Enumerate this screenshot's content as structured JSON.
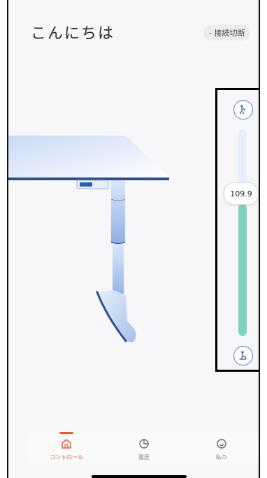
{
  "header": {
    "greeting": "こんにちは",
    "disconnect_label": "- 接続切断"
  },
  "control": {
    "height_value": "109.9",
    "height_level": 0.64,
    "up_icon": "standing-person-icon",
    "down_icon": "sitting-person-icon"
  },
  "tabs": [
    {
      "label": "コントロール",
      "icon": "home-icon",
      "active": true
    },
    {
      "label": "履歴",
      "icon": "pie-chart-icon",
      "active": false
    },
    {
      "label": "私の",
      "icon": "smiley-icon",
      "active": false
    }
  ],
  "colors": {
    "accent": "#e25c3a",
    "slider_fill": "#7fd3c0",
    "slider_track": "#e6eefb",
    "desk_blue": "#a9c2ec"
  }
}
